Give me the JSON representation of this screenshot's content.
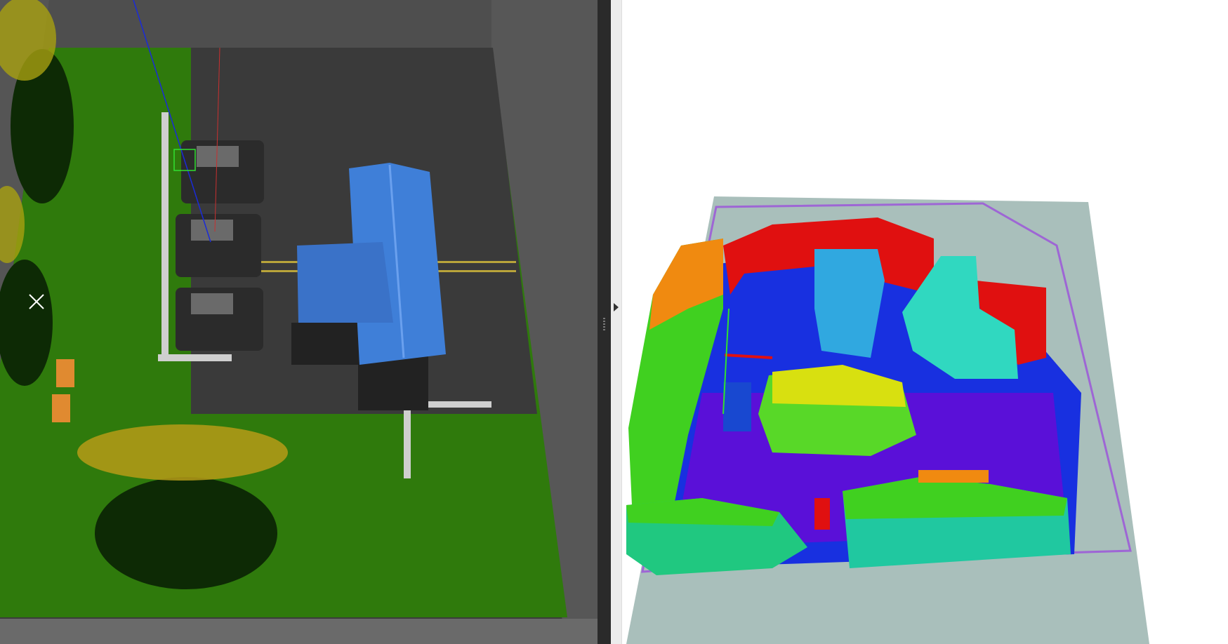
{
  "panels": {
    "simulation": {
      "icon": "gazebo-3d-view"
    },
    "map": {
      "icon": "rviz-octomap-view"
    }
  },
  "colors": {
    "grass": "#2f7a0c",
    "asphalt": "#3a3a3a",
    "wall": "#5a5a5a",
    "house_roof": "#3f7fd8",
    "map_floor": "#a9bfbb",
    "voxel_red": "#e01010",
    "voxel_orange": "#f08a10",
    "voxel_yellow": "#d8e010",
    "voxel_green": "#40d020",
    "voxel_cyan": "#30d8d0",
    "voxel_blue": "#1830e0",
    "voxel_purple": "#5a10d8"
  },
  "divider": {
    "icon": "collapse-arrow-right"
  }
}
